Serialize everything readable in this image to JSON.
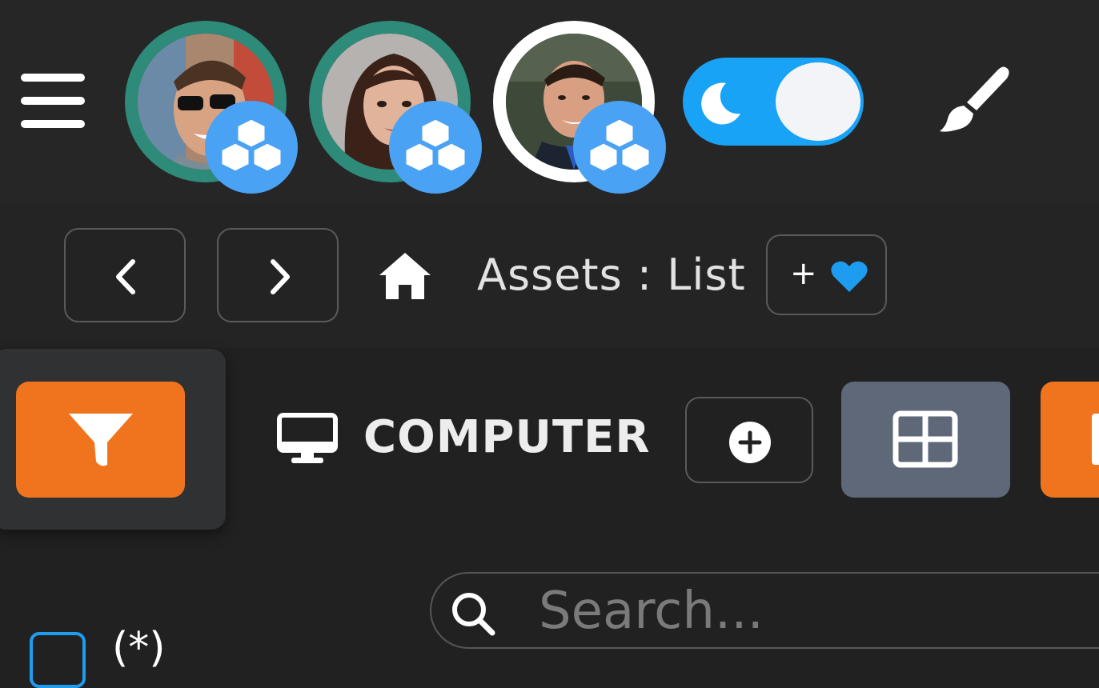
{
  "header": {
    "menu_icon": "hamburger-icon",
    "users": [
      {
        "name": "user-1",
        "ring_color": "#2e8b79",
        "badge_icon": "cubes-icon"
      },
      {
        "name": "user-2",
        "ring_color": "#2e8b79",
        "badge_icon": "cubes-icon"
      },
      {
        "name": "user-3",
        "ring_color": "#ffffff",
        "badge_icon": "cubes-icon"
      }
    ],
    "theme_toggle": {
      "icon": "moon-icon",
      "state": "on",
      "color": "#18a3f7"
    },
    "paint_icon": "brush-icon"
  },
  "breadcrumb": {
    "back_icon": "chevron-left-icon",
    "forward_icon": "chevron-right-icon",
    "home_icon": "home-icon",
    "path": "Assets : List",
    "favorite_plus": "+",
    "favorite_icon": "heart-icon",
    "favorite_color": "#1e9cf0"
  },
  "toolbar": {
    "filter_icon": "filter-icon",
    "section_icon": "monitor-icon",
    "section_title": "COMPUTER",
    "add_icon": "plus-circle-icon",
    "grid_icon": "grid-icon",
    "accent": "#f0741e"
  },
  "search": {
    "placeholder": "Search...",
    "value": ""
  },
  "list": {
    "select_all_label": "(*)"
  }
}
